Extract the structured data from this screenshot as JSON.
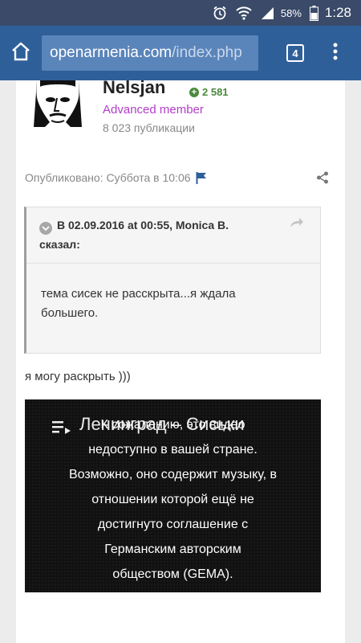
{
  "status_bar": {
    "battery_percent": "58%",
    "time": "1:28"
  },
  "browser": {
    "url_host": "openarmenia.com",
    "url_path": "/index.php",
    "tab_count": "4"
  },
  "post": {
    "author": {
      "name": "Nelsjan",
      "reputation": "2 581",
      "group": "Advanced member",
      "post_count": "8 023 публикации"
    },
    "published": "Опубликовано: Суббота в 10:06",
    "quote": {
      "header_line1": "В 02.09.2016 at 00:55, Monica B.",
      "header_line2": "сказал:",
      "body_line1": "тема сисек не расскрыта...я ждала",
      "body_line2": "большего."
    },
    "reply_text": "я могу раскрыть )))",
    "video": {
      "title": "Ленинград – Сиськи",
      "message_lines": [
        "К сожалению, это видео",
        "недоступно в вашей стране.",
        "Возможно, оно содержит музыку, в",
        "отношении которой ещё не",
        "достигнуто соглашение с",
        "Германским авторским",
        "обществом (GEMA)."
      ]
    }
  }
}
